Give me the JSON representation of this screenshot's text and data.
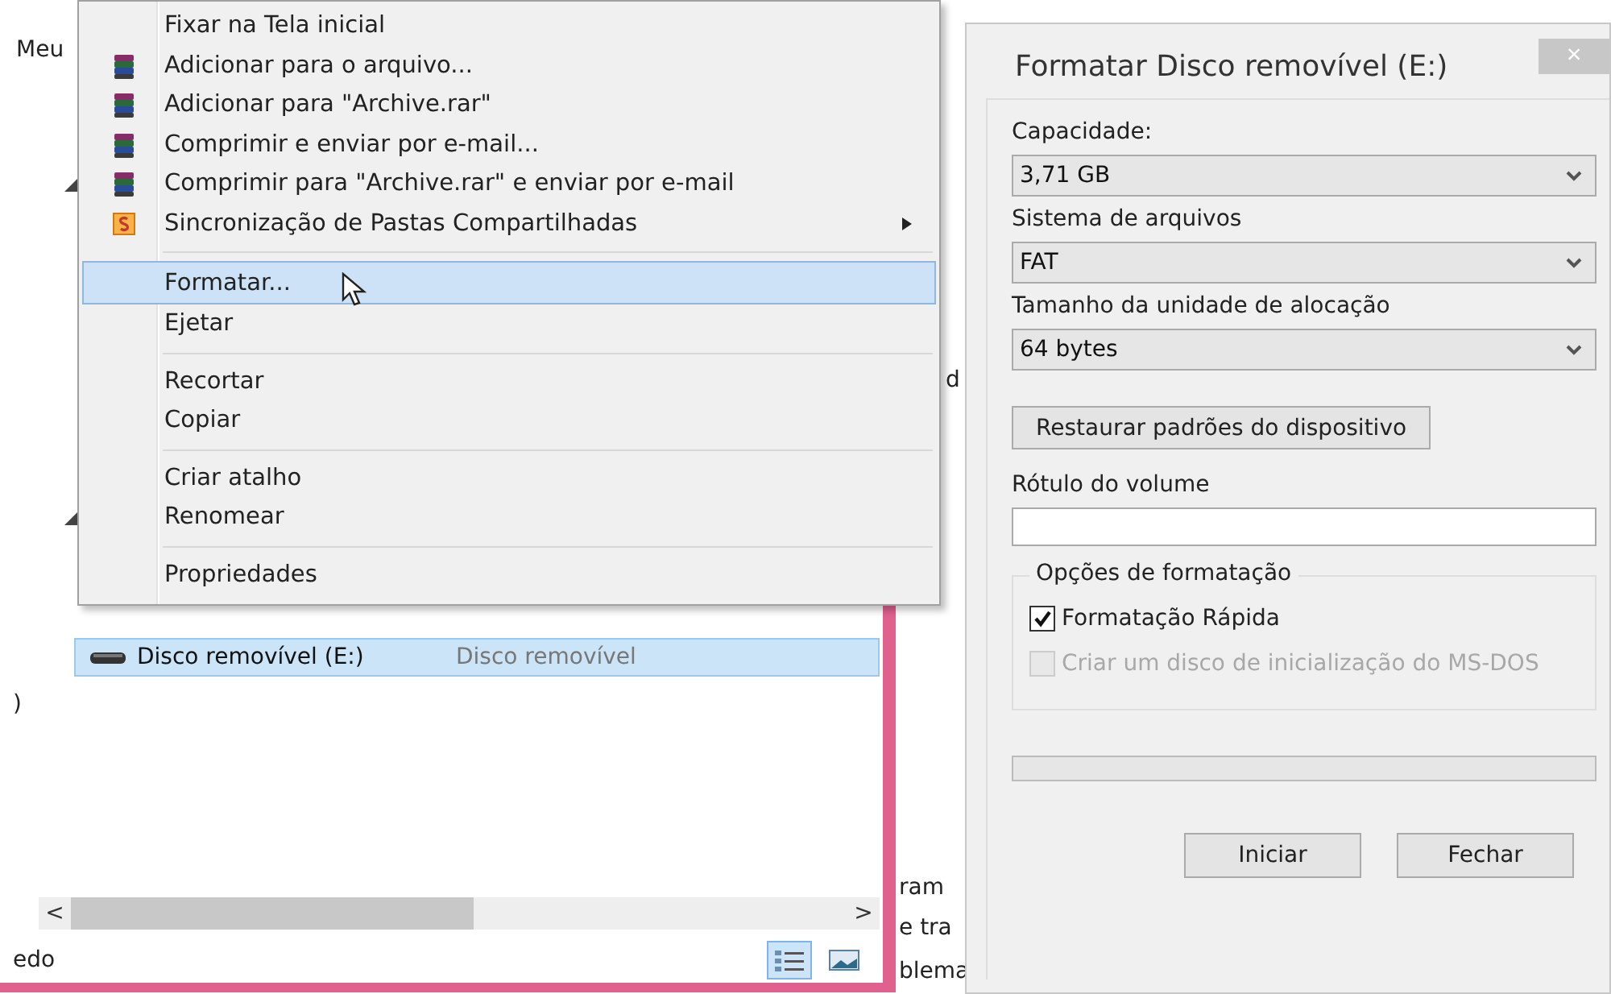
{
  "backdrop": {
    "fragments": [
      "d",
      "ram",
      "e tra",
      "blema"
    ]
  },
  "explorer": {
    "fragments": [
      "Meu",
      ")"
    ],
    "items": [
      {
        "name": "Disco removível (E:)",
        "type": "Disco removível",
        "selected": true
      }
    ],
    "scrollbar": {
      "left": "<",
      "right": ">"
    },
    "status": "edo",
    "views": [
      {
        "kind": "details",
        "selected": true
      },
      {
        "kind": "tiles",
        "selected": false
      }
    ]
  },
  "context_menu": {
    "items": [
      {
        "kind": "plain",
        "label": "Fixar na Tela inicial",
        "submenu": false,
        "selected": false
      },
      {
        "kind": "archive",
        "label": "Adicionar para o arquivo...",
        "submenu": false,
        "selected": false
      },
      {
        "kind": "archive",
        "label": "Adicionar para \"Archive.rar\"",
        "submenu": false,
        "selected": false
      },
      {
        "kind": "archive",
        "label": "Comprimir e enviar por e-mail...",
        "submenu": false,
        "selected": false
      },
      {
        "kind": "archive",
        "label": "Comprimir para \"Archive.rar\" e enviar por e-mail",
        "submenu": false,
        "selected": false
      },
      {
        "kind": "sync",
        "label": "Sincronização de Pastas Compartilhadas",
        "submenu": true,
        "selected": false
      },
      {
        "kind": "separator"
      },
      {
        "kind": "plain",
        "label": "Formatar...",
        "submenu": false,
        "selected": true
      },
      {
        "kind": "plain",
        "label": "Ejetar",
        "submenu": false,
        "selected": false
      },
      {
        "kind": "separator"
      },
      {
        "kind": "plain",
        "label": "Recortar",
        "submenu": false,
        "selected": false
      },
      {
        "kind": "plain",
        "label": "Copiar",
        "submenu": false,
        "selected": false
      },
      {
        "kind": "separator"
      },
      {
        "kind": "plain",
        "label": "Criar atalho",
        "submenu": false,
        "selected": false
      },
      {
        "kind": "plain",
        "label": "Renomear",
        "submenu": false,
        "selected": false
      },
      {
        "kind": "separator"
      },
      {
        "kind": "plain",
        "label": "Propriedades",
        "submenu": false,
        "selected": false
      }
    ]
  },
  "dialog": {
    "title": "Formatar Disco removível (E:)",
    "close": "×",
    "fields": [
      {
        "label": "Capacidade:",
        "value": "3,71 GB"
      },
      {
        "label": "Sistema de arquivos",
        "value": "FAT"
      },
      {
        "label": "Tamanho da unidade de alocação",
        "value": "64 bytes"
      }
    ],
    "restore_button": "Restaurar padrões do dispositivo",
    "volume_label": {
      "label": "Rótulo do volume"
    },
    "format_options": {
      "legend": "Opções de formatação",
      "options": [
        {
          "label": "Formatação Rápida",
          "checked": true,
          "disabled": false
        },
        {
          "label": "Criar um disco de inicialização do MS-DOS",
          "checked": false,
          "disabled": true
        }
      ]
    },
    "progress": {
      "level": 0
    },
    "buttons": [
      "Iniciar",
      "Fechar"
    ]
  }
}
